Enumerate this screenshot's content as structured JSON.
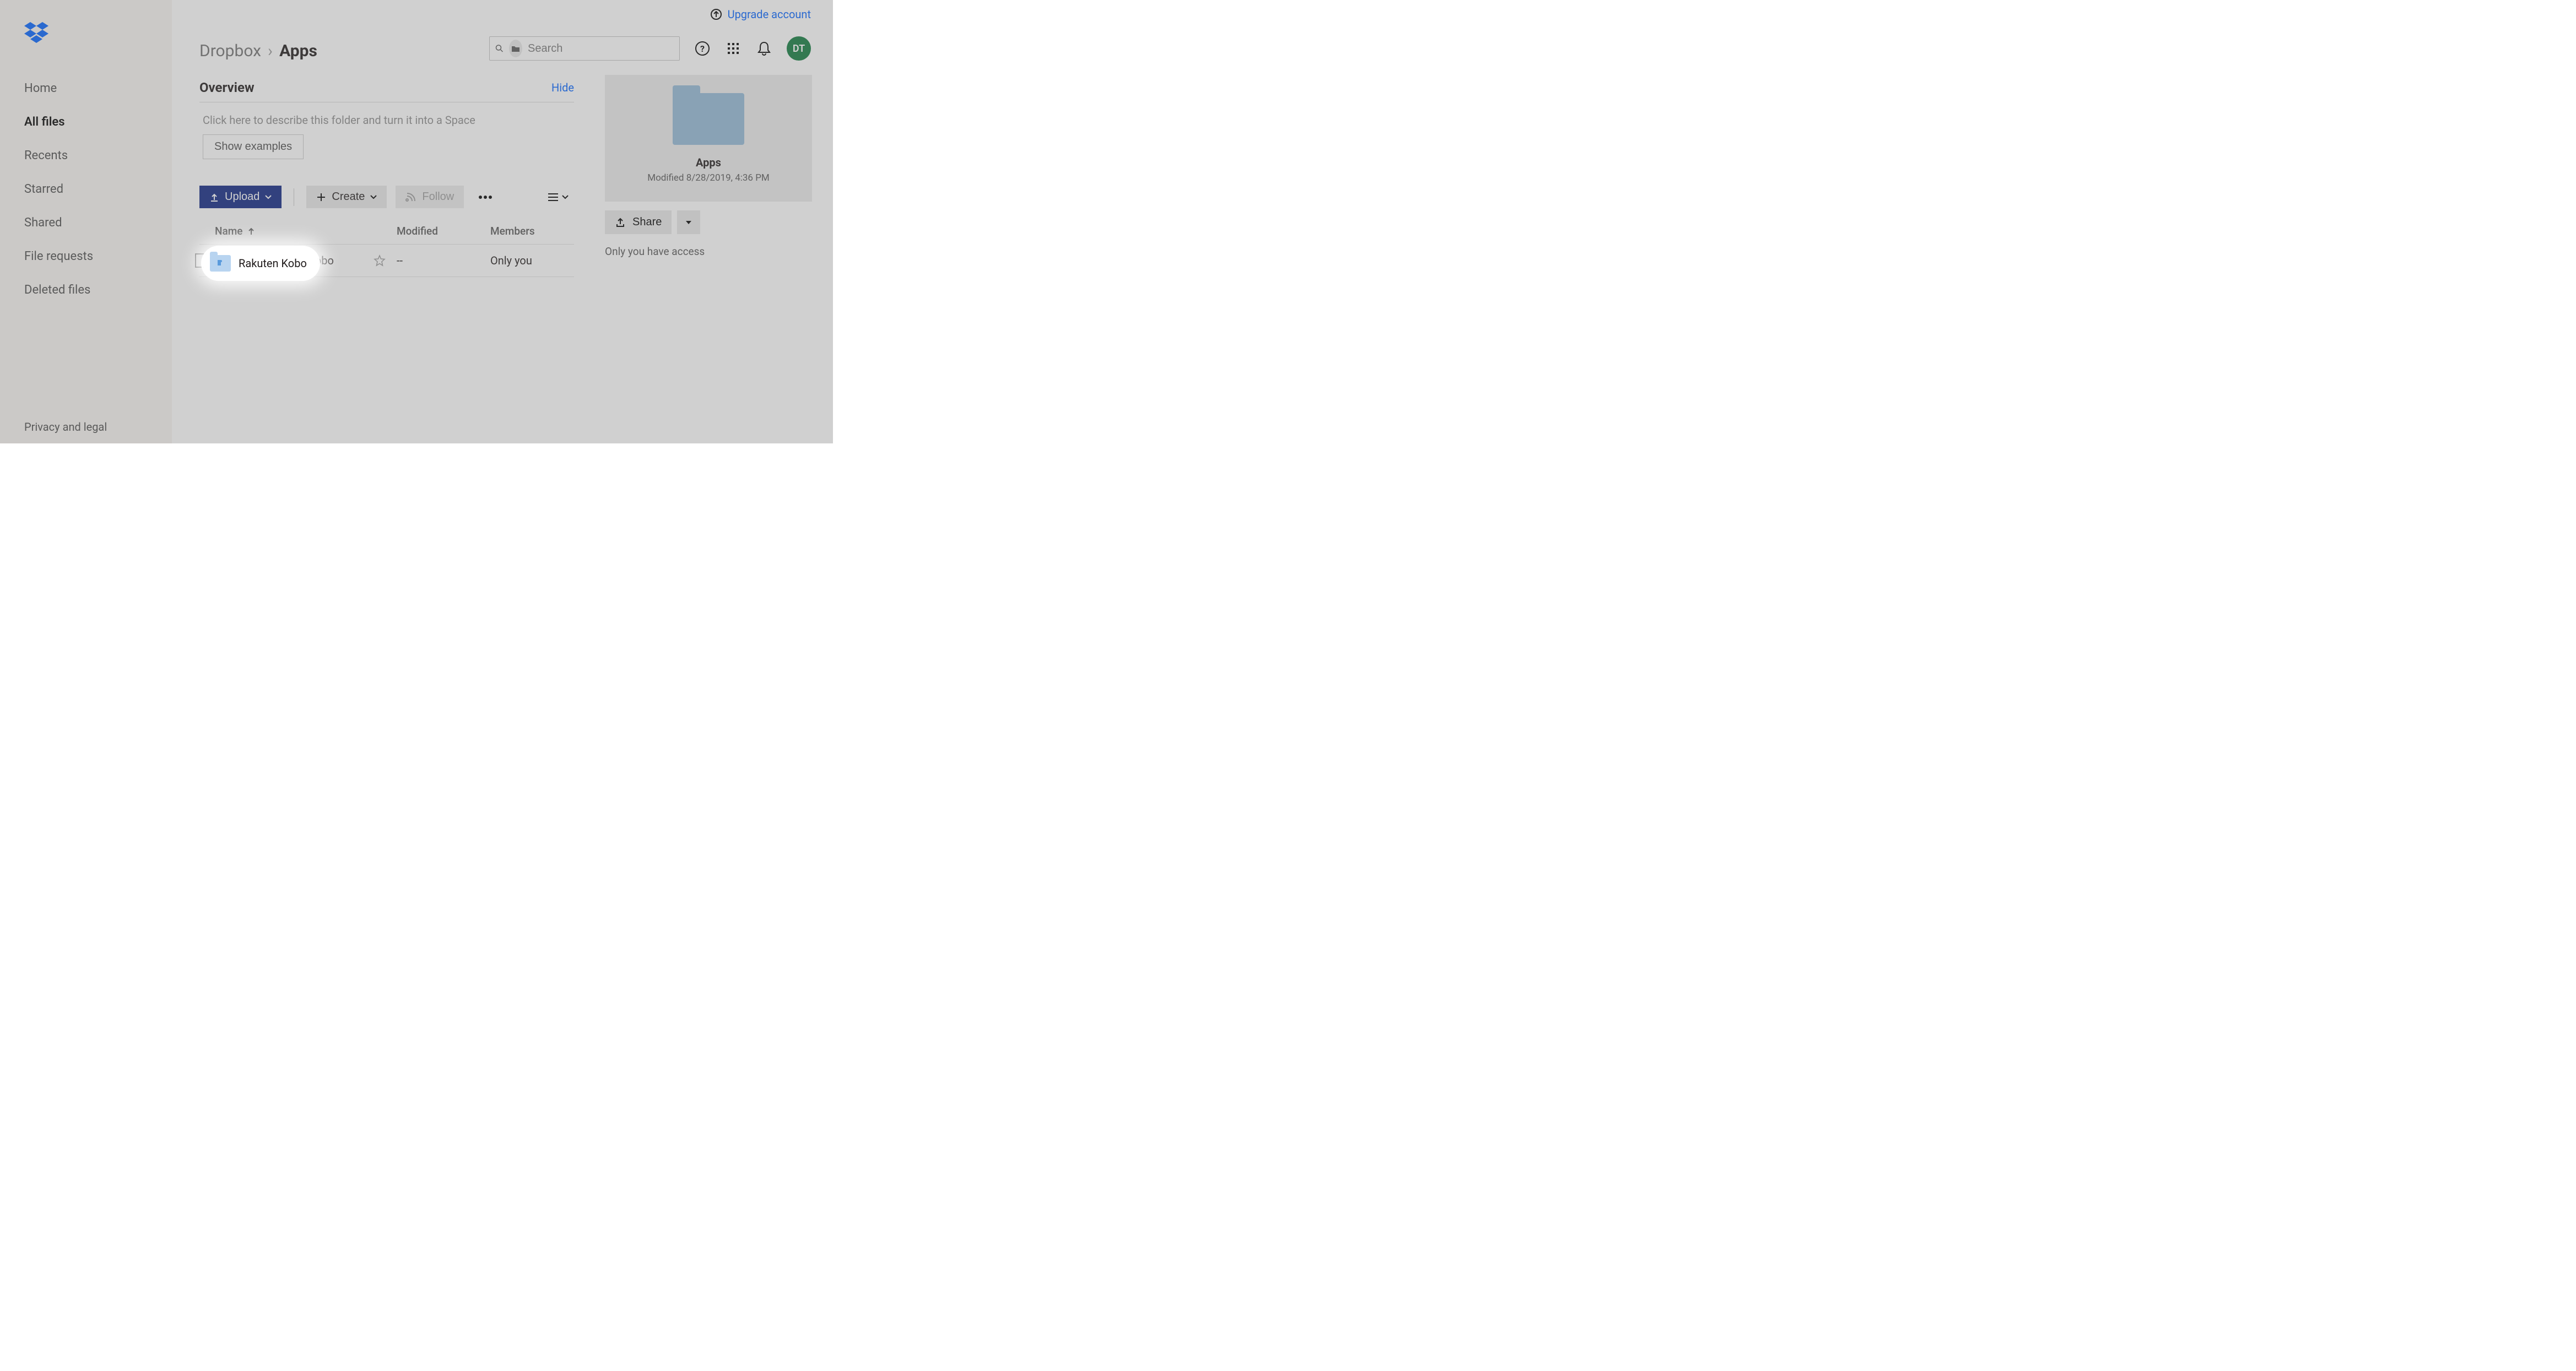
{
  "app": {
    "logo_color": "#0061fe"
  },
  "upgrade": {
    "label": "Upgrade account"
  },
  "sidebar": {
    "items": [
      {
        "label": "Home"
      },
      {
        "label": "All files"
      },
      {
        "label": "Recents"
      },
      {
        "label": "Starred"
      },
      {
        "label": "Shared"
      },
      {
        "label": "File requests"
      },
      {
        "label": "Deleted files"
      }
    ],
    "active_index": 1,
    "footer": "Privacy and legal"
  },
  "breadcrumb": {
    "root": "Dropbox",
    "current": "Apps"
  },
  "search": {
    "placeholder": "Search"
  },
  "avatar": {
    "initials": "DT"
  },
  "overview": {
    "title": "Overview",
    "hide": "Hide",
    "describe_placeholder": "Click here to describe this folder and turn it into a Space",
    "examples": "Show examples"
  },
  "toolbar": {
    "upload": "Upload",
    "create": "Create",
    "follow": "Follow"
  },
  "table": {
    "cols": {
      "name": "Name",
      "modified": "Modified",
      "members": "Members"
    },
    "rows": [
      {
        "name": "Rakuten Kobo",
        "modified": "--",
        "members": "Only you"
      }
    ]
  },
  "preview": {
    "title": "Apps",
    "subtitle": "Modified 8/28/2019, 4:36 PM"
  },
  "share": {
    "label": "Share"
  },
  "access": {
    "text": "Only you have access"
  }
}
